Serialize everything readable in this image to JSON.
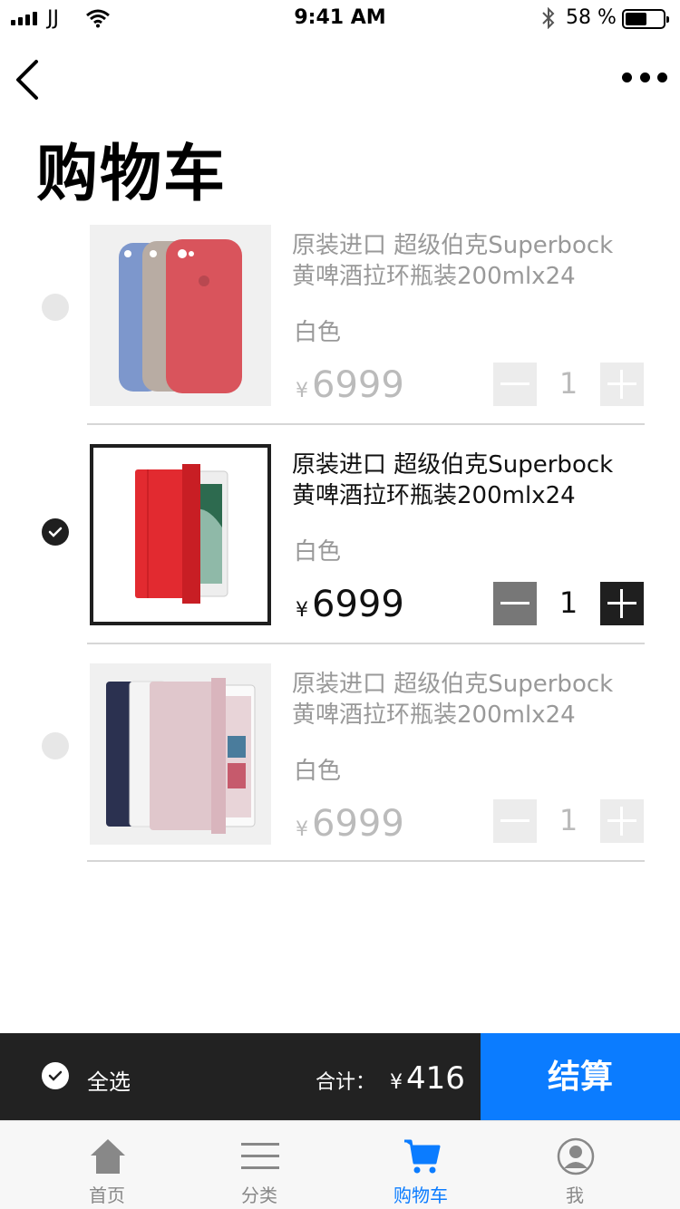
{
  "status_bar": {
    "carrier": "JJ",
    "time": "9:41 AM",
    "battery_text": "58 %",
    "battery_level": 0.58
  },
  "header": {
    "title": "购物车"
  },
  "cart_items": [
    {
      "name_line1": "原装进口 超级伯克Superbock",
      "name_line2": "黄啤酒拉环瓶装200mlx24",
      "color": "白色",
      "currency": "¥",
      "price": "6999",
      "quantity": "1",
      "selected": false
    },
    {
      "name_line1": "原装进口 超级伯克Superbock",
      "name_line2": "黄啤酒拉环瓶装200mlx24",
      "color": "白色",
      "currency": "¥",
      "price": "6999",
      "quantity": "1",
      "selected": true
    },
    {
      "name_line1": "原装进口 超级伯克Superbock",
      "name_line2": "黄啤酒拉环瓶装200mlx24",
      "color": "白色",
      "currency": "¥",
      "price": "6999",
      "quantity": "1",
      "selected": false
    }
  ],
  "checkout_bar": {
    "select_all_label": "全选",
    "total_label": "合计：",
    "currency": "¥",
    "total_value": "416",
    "checkout_label": "结算"
  },
  "tabbar": {
    "items": [
      {
        "label": "首页",
        "icon": "home-icon"
      },
      {
        "label": "分类",
        "icon": "menu-icon"
      },
      {
        "label": "购物车",
        "icon": "cart-icon",
        "active": true
      },
      {
        "label": "我",
        "icon": "user-icon"
      }
    ]
  },
  "colors": {
    "accent": "#0b7cff",
    "dark": "#222222",
    "muted": "#999999"
  }
}
